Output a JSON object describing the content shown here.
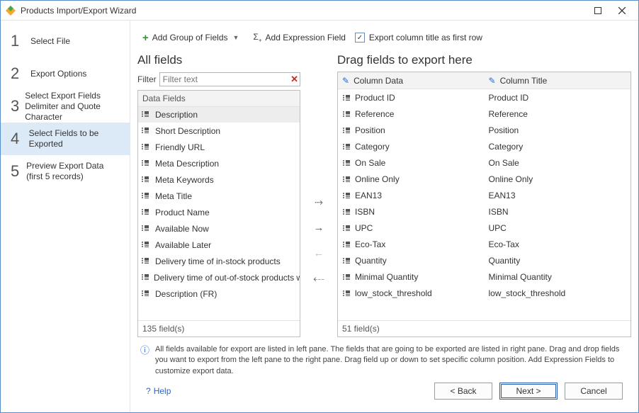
{
  "window": {
    "title": "Products Import/Export Wizard"
  },
  "steps": [
    {
      "num": "1",
      "label": "Select File"
    },
    {
      "num": "2",
      "label": "Export Options"
    },
    {
      "num": "3",
      "label": "Select Export Fields Delimiter and Quote Character"
    },
    {
      "num": "4",
      "label": "Select Fields to be Exported"
    },
    {
      "num": "5",
      "label": "Preview Export Data (first 5 records)"
    }
  ],
  "toolbar": {
    "add_group": "Add Group of Fields",
    "add_expr": "Add Expression Field",
    "export_first_row": "Export column title as first row"
  },
  "left": {
    "title": "All fields",
    "filter_label": "Filter",
    "filter_placeholder": "Filter text",
    "group_header": "Data Fields",
    "items": [
      "Description",
      "Short Description",
      "Friendly URL",
      "Meta Description",
      "Meta Keywords",
      "Meta Title",
      "Product Name",
      "Available Now",
      "Available Later",
      "Delivery time of in-stock products",
      "Delivery time of out-of-stock products with a",
      "Description (FR)"
    ],
    "status": "135 field(s)"
  },
  "right": {
    "title": "Drag fields to export here",
    "col_data": "Column Data",
    "col_title": "Column Title",
    "rows": [
      {
        "data": "Product ID",
        "title": "Product ID"
      },
      {
        "data": "Reference",
        "title": "Reference"
      },
      {
        "data": "Position",
        "title": "Position"
      },
      {
        "data": "Category",
        "title": "Category"
      },
      {
        "data": "On Sale",
        "title": "On Sale"
      },
      {
        "data": "Online Only",
        "title": "Online Only"
      },
      {
        "data": "EAN13",
        "title": "EAN13"
      },
      {
        "data": "ISBN",
        "title": "ISBN"
      },
      {
        "data": "UPC",
        "title": "UPC"
      },
      {
        "data": "Eco-Tax",
        "title": "Eco-Tax"
      },
      {
        "data": "Quantity",
        "title": "Quantity"
      },
      {
        "data": "Minimal Quantity",
        "title": "Minimal Quantity"
      },
      {
        "data": "low_stock_threshold",
        "title": "low_stock_threshold"
      }
    ],
    "status": "51 field(s)"
  },
  "info": "All fields available for export are listed in left pane. The fields that are going to be exported are listed in right pane. Drag and drop fields you want to export from the left pane to the right pane. Drag field up or down to set specific column position. Add Expression Fields to customize export data.",
  "footer": {
    "help": "Help",
    "back": "< Back",
    "next": "Next >",
    "cancel": "Cancel"
  }
}
